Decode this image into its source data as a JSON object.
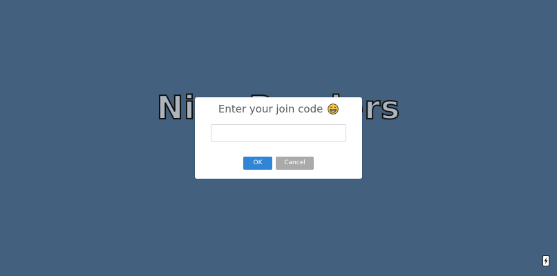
{
  "background": {
    "title": "Nice Readers",
    "color": "#43617f"
  },
  "dialog": {
    "title": "Enter your join code",
    "title_icon": "grinning-face-emoji-icon",
    "input_value": "",
    "ok_label": "OK",
    "cancel_label": "Cancel",
    "ok_color": "#3085d6",
    "cancel_color": "#aaaaaa"
  },
  "corner_button": {
    "icon": "lightning-bolt-icon"
  }
}
